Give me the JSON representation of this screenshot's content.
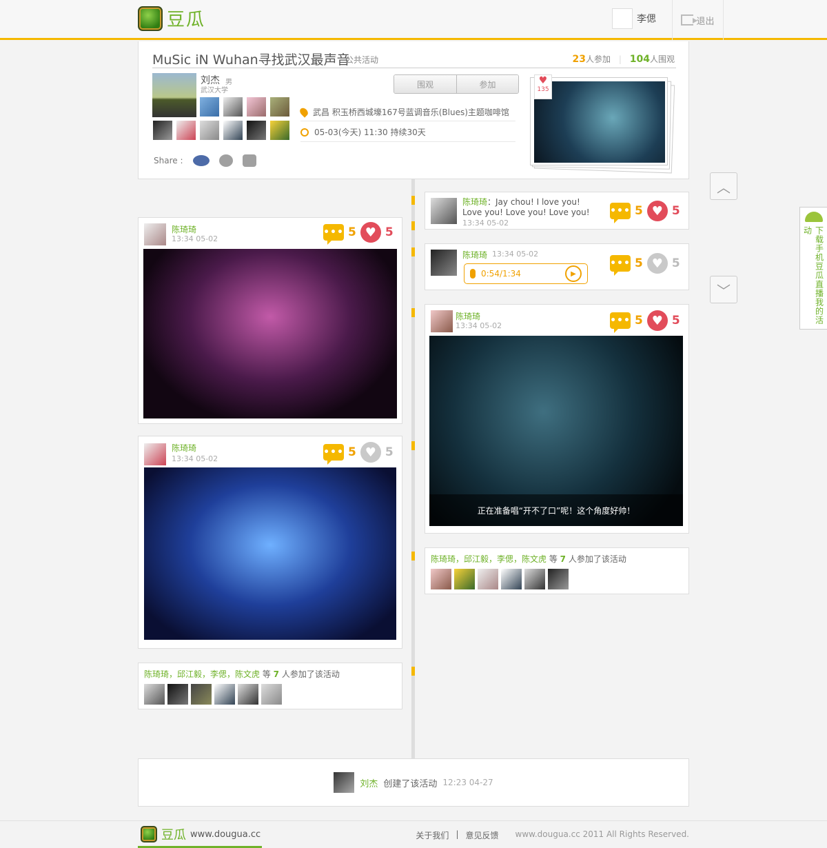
{
  "header": {
    "brand": "豆瓜",
    "user_name": "李偲",
    "logout_label": "退出"
  },
  "event": {
    "title": "MuSic iN Wuhan寻找武汉最声音",
    "type": "公共活动",
    "joined_count": "23",
    "joined_label": "人参加",
    "watch_count": "104",
    "watch_label": "人围观",
    "host_name": "刘杰",
    "host_gender": "男",
    "host_school": "武汉大学",
    "btn_watch": "围观",
    "btn_join": "参加",
    "location": "武昌 积玉桥西城壕167号蓝调音乐(Blues)主题咖啡馆",
    "time": "05-03(今天) 11:30  持续30天",
    "share_label": "Share :",
    "heart_count": "135"
  },
  "posts": {
    "right_text": {
      "name": "陈琦琦",
      "text": "：Jay chou! I love you! Love you! Love you! Love you!",
      "time": "13:34 05-02",
      "comments": "5",
      "likes": "5"
    },
    "left_photo1": {
      "name": "陈琦琦",
      "time": "13:34 05-02",
      "comments": "5",
      "likes": "5"
    },
    "right_audio": {
      "name": "陈琦琦",
      "time": "13:34 05-02",
      "audio": "0:54/1:34",
      "comments": "5",
      "likes": "5"
    },
    "right_photo": {
      "name": "陈琦琦",
      "time": "13:34 05-02",
      "caption": "正在准备唱“开不了口”呢！这个角度好帅！",
      "comments": "5",
      "likes": "5"
    },
    "left_photo2": {
      "name": "陈琦琦",
      "time": "13:34 05-02",
      "comments": "5",
      "likes": "5"
    },
    "joined_right": {
      "names": "陈琦琦，邱江毅，李偲，陈文虎",
      "mid": " 等 ",
      "count": "7",
      "tail": " 人参加了该活动"
    },
    "joined_left": {
      "names": "陈琦琦，邱江毅，李偲，陈文虎",
      "mid": " 等 ",
      "count": "7",
      "tail": " 人参加了该活动"
    }
  },
  "created": {
    "name": "刘杰",
    "text": "创建了该活动",
    "time": "12:23  04-27"
  },
  "sidebar": {
    "android_text": "下载手机豆瓜直播我的活动"
  },
  "footer": {
    "brand": "豆瓜",
    "url": "www.dougua.cc",
    "about": "关于我们",
    "sep": "|",
    "feedback": "意见反馈",
    "copyright": "www.dougua.cc 2011 All Rights Reserved."
  },
  "colors": {
    "accent": "#f5b800",
    "green": "#6fb229",
    "heart": "#e24c5a"
  }
}
